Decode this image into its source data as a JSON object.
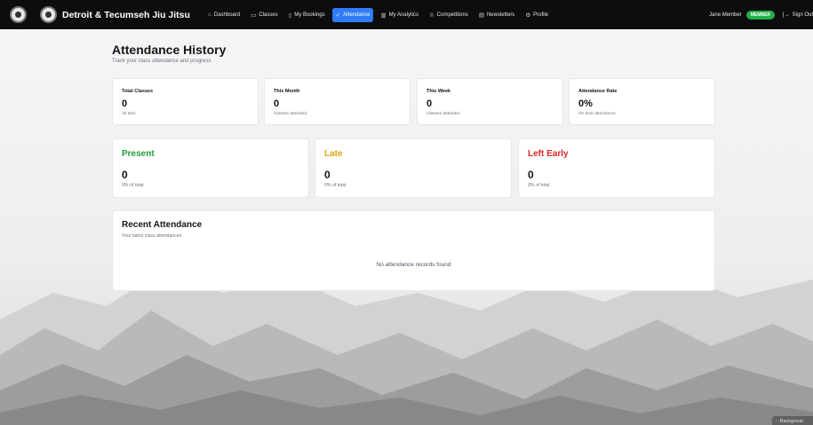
{
  "nav": {
    "brand": "Detroit & Tecumseh Jiu Jitsu",
    "links": [
      {
        "label": "Dashboard",
        "icon": "home-icon"
      },
      {
        "label": "Classes",
        "icon": "calendar-icon"
      },
      {
        "label": "My Bookings",
        "icon": "book-icon"
      },
      {
        "label": "Attendance",
        "icon": "user-check-icon"
      },
      {
        "label": "My Analytics",
        "icon": "chart-icon"
      },
      {
        "label": "Competitions",
        "icon": "trophy-icon"
      },
      {
        "label": "Newsletters",
        "icon": "newspaper-icon"
      },
      {
        "label": "Profile",
        "icon": "gear-icon"
      }
    ],
    "active": "Attendance",
    "user_name": "Jane Member",
    "role_badge": "MEMBER",
    "sign_out": "Sign Out"
  },
  "page": {
    "title": "Attendance History",
    "subtitle": "Track your class attendance and progress"
  },
  "stats": [
    {
      "label": "Total Classes",
      "value": "0",
      "note": "All time"
    },
    {
      "label": "This Month",
      "value": "0",
      "note": "Classes attended"
    },
    {
      "label": "This Week",
      "value": "0",
      "note": "Classes attended"
    },
    {
      "label": "Attendance Rate",
      "value": "0%",
      "note": "On time attendance"
    }
  ],
  "status_cards": [
    {
      "title": "Present",
      "value": "0",
      "note": "0% of total",
      "color": "#1f9d3a"
    },
    {
      "title": "Late",
      "value": "0",
      "note": "0% of total",
      "color": "#d9a514"
    },
    {
      "title": "Left Early",
      "value": "0",
      "note": "0% of total",
      "color": "#dc2626"
    }
  ],
  "recent": {
    "title": "Recent Attendance",
    "subtitle": "Your latest class attendances",
    "empty": "No attendance records found"
  },
  "background_button": "Backgroun"
}
